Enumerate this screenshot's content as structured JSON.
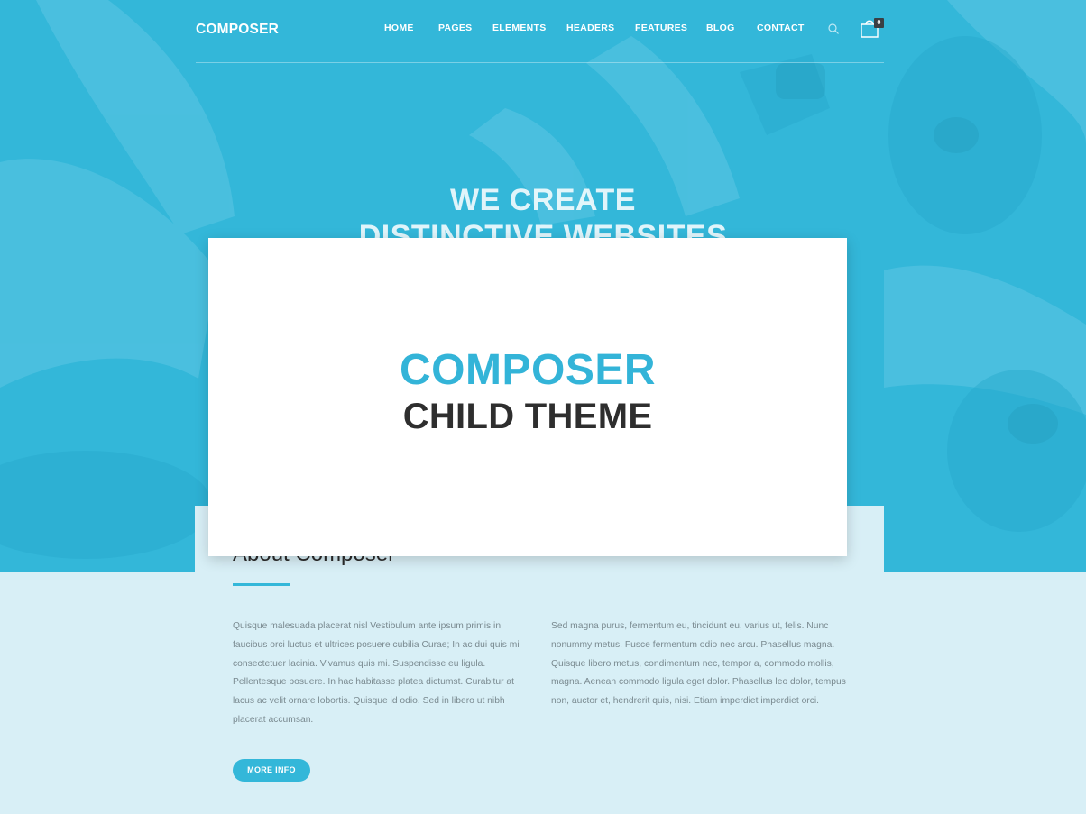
{
  "header": {
    "logo_text": "COMPOSER",
    "nav": [
      {
        "id": "home",
        "label": "HOME"
      },
      {
        "id": "pages",
        "label": "PAGES"
      },
      {
        "id": "elements",
        "label": "ELEMENTS"
      },
      {
        "id": "headers",
        "label": "HEADERS"
      },
      {
        "id": "features",
        "label": "FEATURES"
      },
      {
        "id": "blog",
        "label": "BLOG"
      },
      {
        "id": "contact",
        "label": "CONTACT"
      }
    ],
    "search_icon": "search-icon",
    "cart_icon": "shopping-bag-icon",
    "cart_count": "0"
  },
  "hero": {
    "title_line1": "WE CREATE",
    "title_line2": "DISTINCTIVE WEBSITES"
  },
  "about": {
    "title": "About Composer",
    "col1": "Quisque malesuada placerat nisl Vestibulum ante ipsum primis in faucibus orci luctus et ultrices posuere cubilia Curae; In ac dui quis mi consectetuer lacinia. Vivamus quis mi. Suspendisse eu ligula. Pellentesque posuere. In hac habitasse platea dictumst. Curabitur at lacus ac velit ornare lobortis. Quisque id odio. Sed in libero ut nibh placerat accumsan.",
    "col2": "Sed magna purus, fermentum eu, tincidunt eu, varius ut, felis. Nunc nonummy metus. Fusce fermentum odio nec arcu. Phasellus magna. Quisque libero metus, condimentum nec, tempor a, commodo mollis, magna. Aenean commodo ligula eget dolor. Phasellus leo dolor, tempus non, auctor et, hendrerit quis, nisi. Etiam imperdiet imperdiet orci.",
    "button_label": "MORE INFO"
  },
  "overlay": {
    "line1": "COMPOSER",
    "line2": "CHILD THEME"
  },
  "colors": {
    "accent": "#33b7d9",
    "hero_bg": "#33b7d9",
    "content_bg": "#d8eff6",
    "dark_text": "#2e2e2e"
  }
}
